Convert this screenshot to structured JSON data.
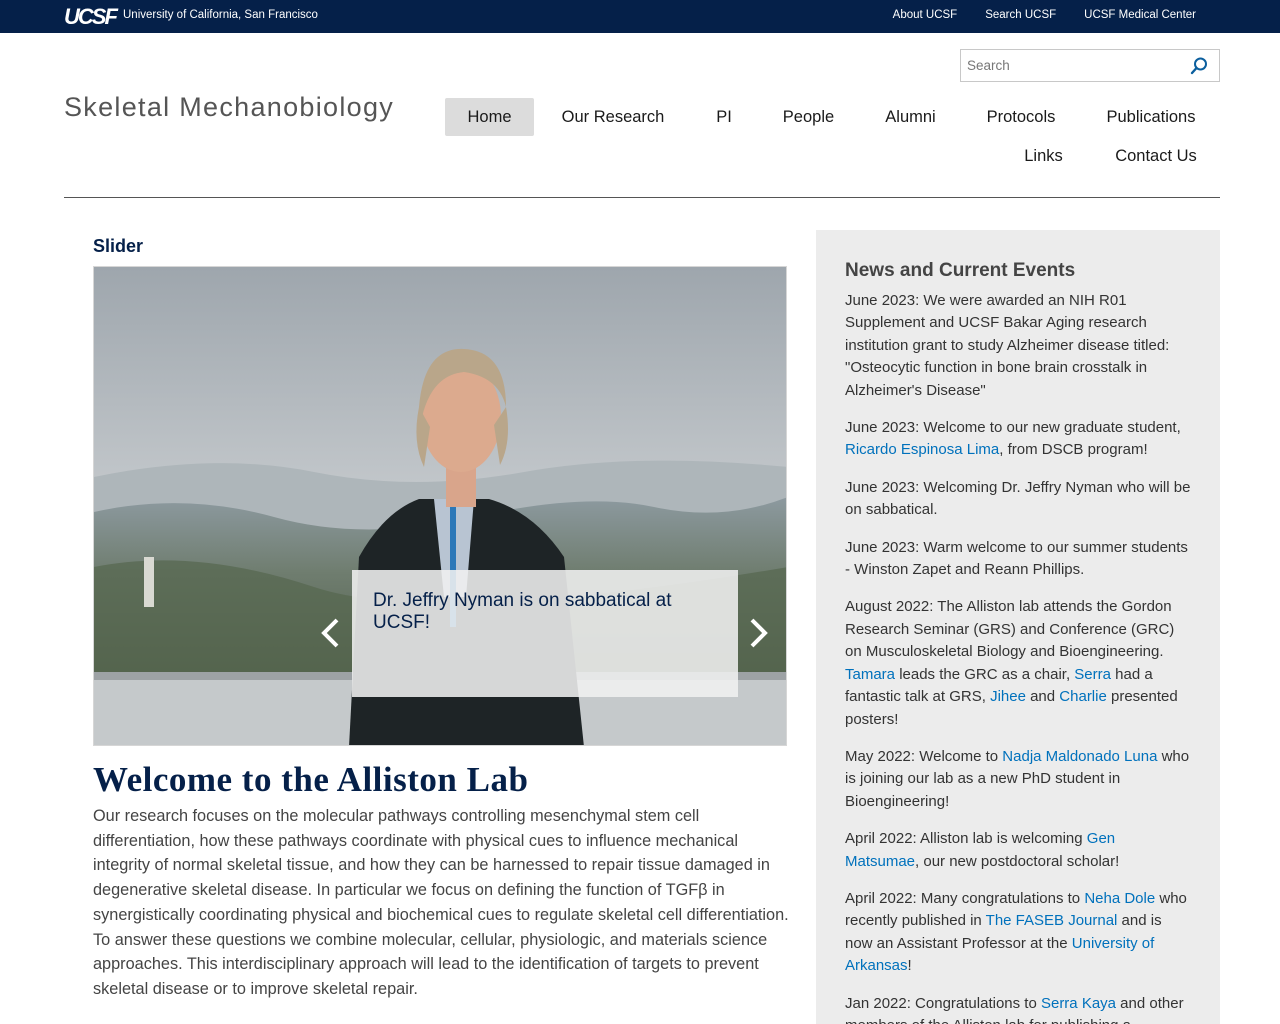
{
  "topbar": {
    "logo_text": "UCSF",
    "university": "University of California, San Francisco",
    "links": [
      "About UCSF",
      "Search UCSF",
      "UCSF Medical Center"
    ]
  },
  "header": {
    "site_title": "Skeletal Mechanobiology",
    "search_placeholder": "Search",
    "nav": [
      {
        "label": "Home",
        "active": true
      },
      {
        "label": "Our Research",
        "active": false
      },
      {
        "label": "PI",
        "active": false
      },
      {
        "label": "People",
        "active": false
      },
      {
        "label": "Alumni",
        "active": false
      },
      {
        "label": "Protocols",
        "active": false
      },
      {
        "label": "Publications",
        "active": false
      },
      {
        "label": "Links",
        "active": false
      },
      {
        "label": "Contact Us",
        "active": false
      }
    ]
  },
  "main": {
    "slider_heading": "Slider",
    "slide_caption": "Dr. Jeffry Nyman is on sabbatical at UCSF!",
    "welcome_title": "Welcome to the Alliston Lab",
    "intro": "Our research focuses on the molecular pathways controlling mesenchymal stem cell differentiation, how these pathways coordinate with physical cues to influence mechanical integrity of normal skeletal tissue, and how they can be harnessed to repair tissue damaged in degenerative skeletal disease. In particular we focus on defining the function of TGFβ in synergistically coordinating physical and biochemical cues to regulate skeletal cell differentiation. To answer these questions we combine molecular, cellular, physiologic, and materials science approaches. This interdisciplinary approach will lead to the identification of targets to prevent skeletal disease or to improve skeletal repair."
  },
  "news": {
    "heading": "News and Current Events",
    "items": [
      [
        {
          "t": "June 2023: We were awarded an NIH R01 Supplement and UCSF Bakar Aging research institution grant to study Alzheimer disease titled: \"Osteocytic function in bone brain crosstalk in Alzheimer's Disease\""
        }
      ],
      [
        {
          "t": "June 2023: Welcome to our new graduate student, "
        },
        {
          "t": "Ricardo Espinosa Lima",
          "link": true
        },
        {
          "t": ", from DSCB program!"
        }
      ],
      [
        {
          "t": "June 2023: Welcoming Dr. Jeffry Nyman who will be on sabbatical."
        }
      ],
      [
        {
          "t": "June 2023: Warm welcome to our summer students - Winston Zapet and Reann Phillips."
        }
      ],
      [
        {
          "t": "August 2022: The Alliston lab attends the Gordon Research Seminar (GRS) and Conference (GRC) on Musculoskeletal Biology and Bioengineering. "
        },
        {
          "t": "Tamara",
          "link": true
        },
        {
          "t": " leads the GRC as a chair, "
        },
        {
          "t": "Serra",
          "link": true
        },
        {
          "t": " had a fantastic talk at GRS, "
        },
        {
          "t": "Jihee",
          "link": true
        },
        {
          "t": " and "
        },
        {
          "t": "Charlie",
          "link": true
        },
        {
          "t": " presented posters!"
        }
      ],
      [
        {
          "t": "May 2022: Welcome to "
        },
        {
          "t": "Nadja Maldonado Luna",
          "link": true
        },
        {
          "t": " who is joining our lab as a new PhD student in Bioengineering!"
        }
      ],
      [
        {
          "t": "April 2022: Alliston lab is welcoming "
        },
        {
          "t": "Gen Matsumae",
          "link": true
        },
        {
          "t": ", our new postdoctoral scholar!"
        }
      ],
      [
        {
          "t": "April 2022: Many congratulations to "
        },
        {
          "t": "Neha Dole",
          "link": true
        },
        {
          "t": " who recently published in "
        },
        {
          "t": "The FASEB Journal",
          "link": true
        },
        {
          "t": " and is now an Assistant Professor at the "
        },
        {
          "t": "University of Arkansas",
          "link": true
        },
        {
          "t": "!"
        }
      ],
      [
        {
          "t": "Jan 2022: Congratulations to "
        },
        {
          "t": "Serra Kaya",
          "link": true
        },
        {
          "t": " and other members of the Alliston lab for publishing a"
        }
      ]
    ]
  },
  "colors": {
    "navy": "#052049",
    "link": "#0071bc",
    "sidebar_bg": "#ececec",
    "active_nav_bg": "#dcdcdc"
  },
  "icons": [
    "search-icon",
    "chevron-left-icon",
    "chevron-right-icon"
  ]
}
